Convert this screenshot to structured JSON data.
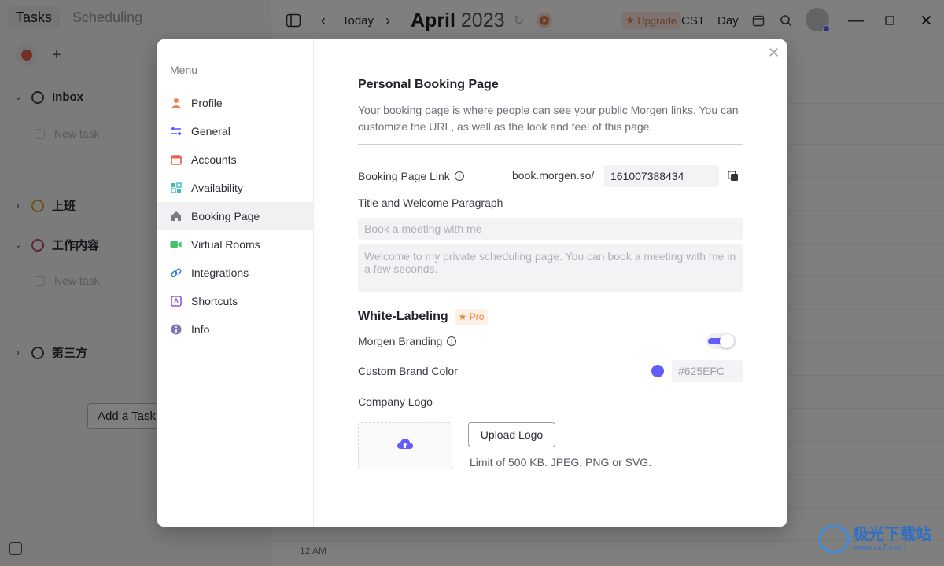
{
  "app": {
    "tabs": [
      "Tasks",
      "Scheduling"
    ],
    "groups": [
      {
        "name": "Inbox",
        "color": "#444444"
      },
      {
        "name": "上班",
        "color": "#d4a32a"
      },
      {
        "name": "工作内容",
        "color": "#c2407a"
      },
      {
        "name": "第三方",
        "color": "#444444"
      }
    ],
    "new_task_placeholder": "New task",
    "add_task_label": "Add a Task",
    "topbar": {
      "today": "Today",
      "month": "April",
      "year": "2023",
      "upgrade": "Upgrade",
      "timezone": "CST",
      "view": "Day"
    },
    "time_label": "12 AM"
  },
  "settings": {
    "menu_heading": "Menu",
    "menu": [
      {
        "label": "Profile",
        "icon": "profile-icon",
        "color": "#e8844f"
      },
      {
        "label": "General",
        "icon": "general-icon",
        "color": "#625EFC"
      },
      {
        "label": "Accounts",
        "icon": "calendar-icon",
        "color": "#e8604c"
      },
      {
        "label": "Availability",
        "icon": "availability-icon",
        "color": "#3fb8c9"
      },
      {
        "label": "Booking Page",
        "icon": "home-icon",
        "color": "#7a7a82",
        "active": true
      },
      {
        "label": "Virtual Rooms",
        "icon": "video-icon",
        "color": "#3fc26b"
      },
      {
        "label": "Integrations",
        "icon": "link-icon",
        "color": "#3d7ad6"
      },
      {
        "label": "Shortcuts",
        "icon": "shortcuts-icon",
        "color": "#8b5cd6"
      },
      {
        "label": "Info",
        "icon": "info-icon",
        "color": "#7a7ab8"
      }
    ],
    "booking": {
      "title": "Personal Booking Page",
      "description": "Your booking page is where people can see your public Morgen links. You can customize the URL, as well as the look and feel of this page.",
      "link_label": "Booking Page Link",
      "link_prefix": "book.morgen.so/",
      "link_value": "161007388434",
      "title_section_label": "Title and Welcome Paragraph",
      "title_placeholder": "Book a meeting with me",
      "welcome_placeholder": "Welcome to my private scheduling page. You can book a meeting with me in a few seconds."
    },
    "white_labeling": {
      "title": "White-Labeling",
      "badge": "Pro",
      "branding_label": "Morgen Branding",
      "branding_enabled": true,
      "brand_color_label": "Custom Brand Color",
      "brand_color": "#625EFC",
      "brand_color_placeholder": "#625EFC",
      "logo_label": "Company Logo",
      "upload_button": "Upload Logo",
      "limit_text": "Limit of 500 KB. JPEG, PNG or SVG."
    }
  },
  "watermark": {
    "title": "极光下载站",
    "url": "www.xz7.com"
  }
}
